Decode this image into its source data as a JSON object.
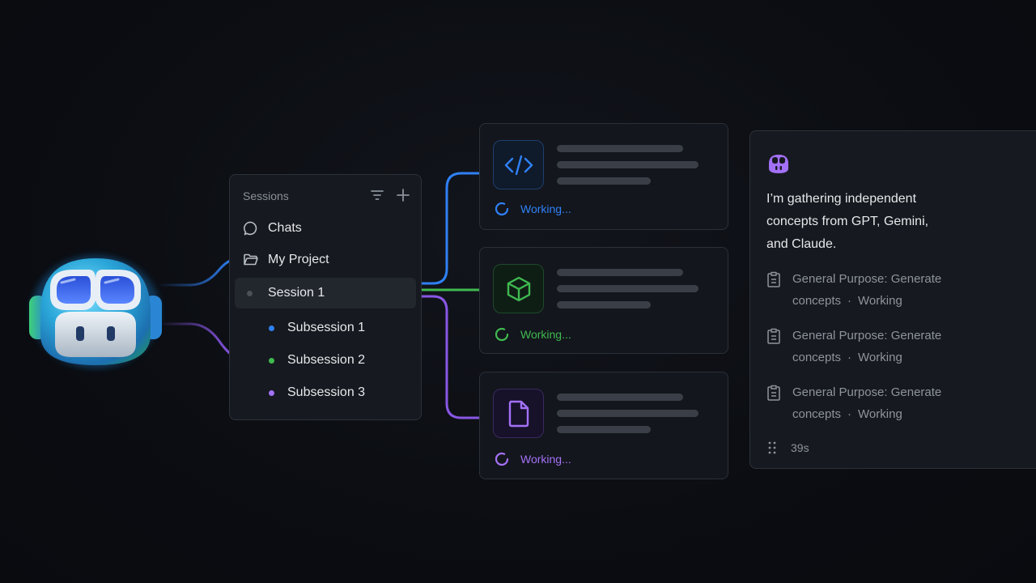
{
  "colors": {
    "blue": "#2f81f7",
    "green": "#3fb950",
    "purple": "#a371f7"
  },
  "sessions": {
    "header": "Sessions",
    "icons": [
      "filter-icon",
      "plus-icon"
    ],
    "items": [
      {
        "label": "Chats",
        "icon": "chat-bubble-icon"
      },
      {
        "label": "My Project",
        "icon": "folder-icon"
      },
      {
        "label": "Session 1",
        "icon": "dot"
      },
      {
        "label": "Subsession 1",
        "color": "blue"
      },
      {
        "label": "Subsession 2",
        "color": "green"
      },
      {
        "label": "Subsession 3",
        "color": "purple"
      }
    ]
  },
  "cards": [
    {
      "icon": "code-icon",
      "status": "Working...",
      "color": "blue"
    },
    {
      "icon": "package-icon",
      "status": "Working...",
      "color": "green"
    },
    {
      "icon": "file-icon",
      "status": "Working...",
      "color": "purple"
    }
  ],
  "agent": {
    "icon": "copilot-icon",
    "message": "I’m gathering independent concepts from GPT, Gemini, and Claude.",
    "tasks": [
      {
        "line1": "General Purpose: Generate",
        "line2": "concepts",
        "sep": "·",
        "status": "Working"
      },
      {
        "line1": "General Purpose: Generate",
        "line2": "concepts",
        "sep": "·",
        "status": "Working"
      },
      {
        "line1": "General Purpose: Generate",
        "line2": "concepts",
        "sep": "·",
        "status": "Working"
      }
    ],
    "timer": "39s"
  }
}
